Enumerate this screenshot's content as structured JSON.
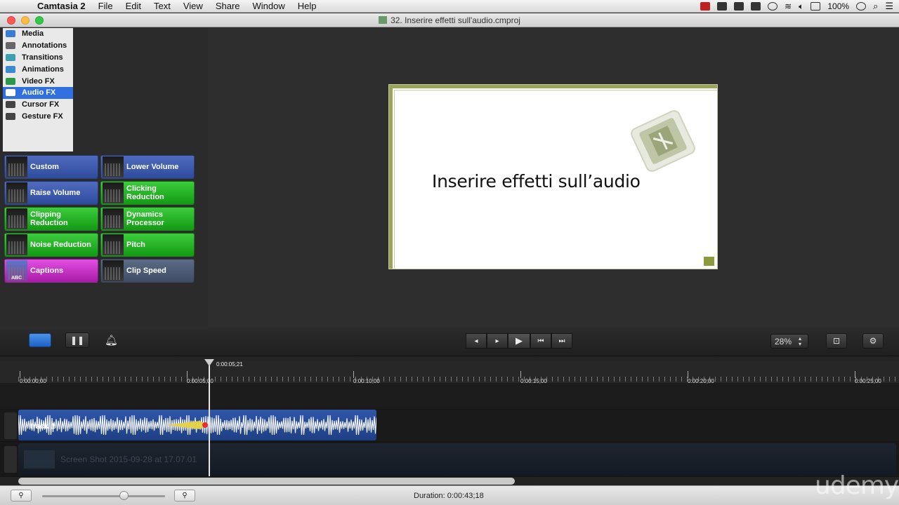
{
  "menubar": {
    "app_name": "Camtasia 2",
    "menus": [
      "File",
      "Edit",
      "Text",
      "View",
      "Share",
      "Window",
      "Help"
    ],
    "battery": "100%"
  },
  "window": {
    "title": "32. Inserire effetti sull'audio.cmproj"
  },
  "tasks": [
    {
      "label": "Media",
      "icon": "media-icon",
      "color": "#3a7bd5"
    },
    {
      "label": "Annotations",
      "icon": "annotations-icon",
      "color": "#666"
    },
    {
      "label": "Transitions",
      "icon": "transitions-icon",
      "color": "#3aa0b0"
    },
    {
      "label": "Animations",
      "icon": "animations-icon",
      "color": "#3a8ad0"
    },
    {
      "label": "Video FX",
      "icon": "video-fx-icon",
      "color": "#2a9a4a"
    },
    {
      "label": "Audio FX",
      "icon": "audio-fx-icon",
      "color": "#ffffff",
      "selected": true
    },
    {
      "label": "Cursor FX",
      "icon": "cursor-fx-icon",
      "color": "#444"
    },
    {
      "label": "Gesture FX",
      "icon": "gesture-fx-icon",
      "color": "#444"
    }
  ],
  "effects": [
    {
      "label": "Custom",
      "style": "blue"
    },
    {
      "label": "Lower Volume",
      "style": "blue"
    },
    {
      "label": "Raise Volume",
      "style": "blue"
    },
    {
      "label": "Clicking Reduction",
      "style": "green"
    },
    {
      "label": "Clipping Reduction",
      "style": "green"
    },
    {
      "label": "Dynamics Processor",
      "style": "green"
    },
    {
      "label": "Noise Reduction",
      "style": "green"
    },
    {
      "label": "Pitch",
      "style": "green"
    },
    {
      "label": "Captions",
      "style": "magenta",
      "thumb_text": "ABC"
    },
    {
      "label": "Clip Speed",
      "style": "slate"
    }
  ],
  "canvas": {
    "slide_title": "Inserire effetti sull’audio"
  },
  "toolbar": {
    "zoom": "28%",
    "transport": [
      "◂",
      "▸",
      "▶",
      "⏮",
      "⏭"
    ]
  },
  "timeline": {
    "playhead_time": "0:00:05;21",
    "tick_labels": [
      "0:00:00;00",
      "0:00:05;00",
      "0:00:10;00",
      "0:00:15;00",
      "0:00:20;00",
      "0:00:25;00"
    ],
    "audio_track_label": "track 1",
    "video_clip_label": "Screen Shot 2015-09-28 at 17.07.01"
  },
  "statusbar": {
    "duration": "Duration: 0:00:43;18"
  },
  "watermark": "udemy"
}
